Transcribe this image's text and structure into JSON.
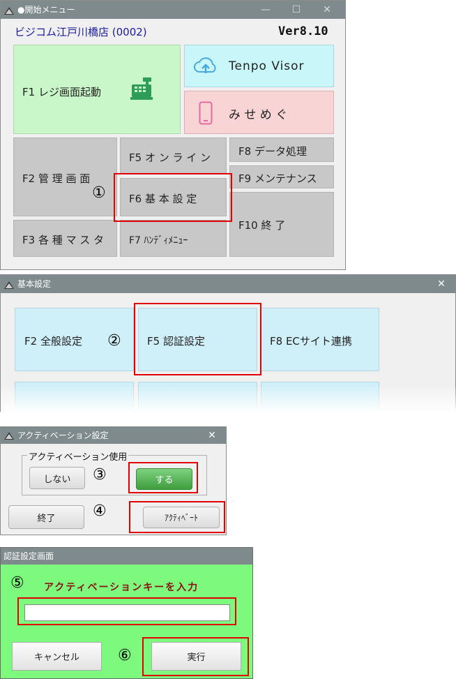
{
  "win1": {
    "title": "●開始メニュー",
    "store_name": "ビジコム江戸川橋店 (0002)",
    "version": "Ver8.10",
    "f1_label": "F1 レジ画面起動",
    "tenpo_visor_label": "Tenpo Visor",
    "misemegu_label": "み せ め ぐ",
    "f2_label": "F2 管 理 画 面",
    "f3_label": "F3 各 種 マ ス タ",
    "f5_label": "F5 オ ン ラ イ ン",
    "f6_label": "F6 基 本 設 定",
    "f7_label": "F7 ﾊﾝﾃﾞｨﾒﾆｭｰ",
    "f8_label": "F8 データ処理",
    "f9_label": "F9 メンテナンス",
    "f10_label": "F10 終 了",
    "step_marker": "①"
  },
  "win2": {
    "title": "基本設定",
    "f2_label": "F2 全般設定",
    "f5_label": "F5 認証設定",
    "f8_label": "F8 ECサイト連携",
    "step_marker": "②"
  },
  "win3": {
    "title": "アクティベーション設定",
    "group_label": "アクティベーション使用",
    "no_label": "しない",
    "yes_label": "する",
    "exit_label": "終了",
    "activate_label": "ｱｸﾃｨﾍﾞｰﾄ",
    "step_marker_3": "③",
    "step_marker_4": "④"
  },
  "win4": {
    "title": "認証設定画面",
    "prompt": "アクティベーションキーを入力",
    "key_value": "",
    "cancel_label": "キャンセル",
    "run_label": "実行",
    "step_marker_5": "⑤",
    "step_marker_6": "⑥"
  },
  "colors": {
    "titlebar": "#7f8a8c",
    "f1_green": "#c9f7c9",
    "tenpo_cyan": "#c8f6f9",
    "misemegu_pink": "#f8d4d4",
    "tile_blue": "#cfeff9",
    "auth_green": "#7dfa7d",
    "yes_green": "#5cb85c",
    "highlight_red": "#e00000"
  }
}
